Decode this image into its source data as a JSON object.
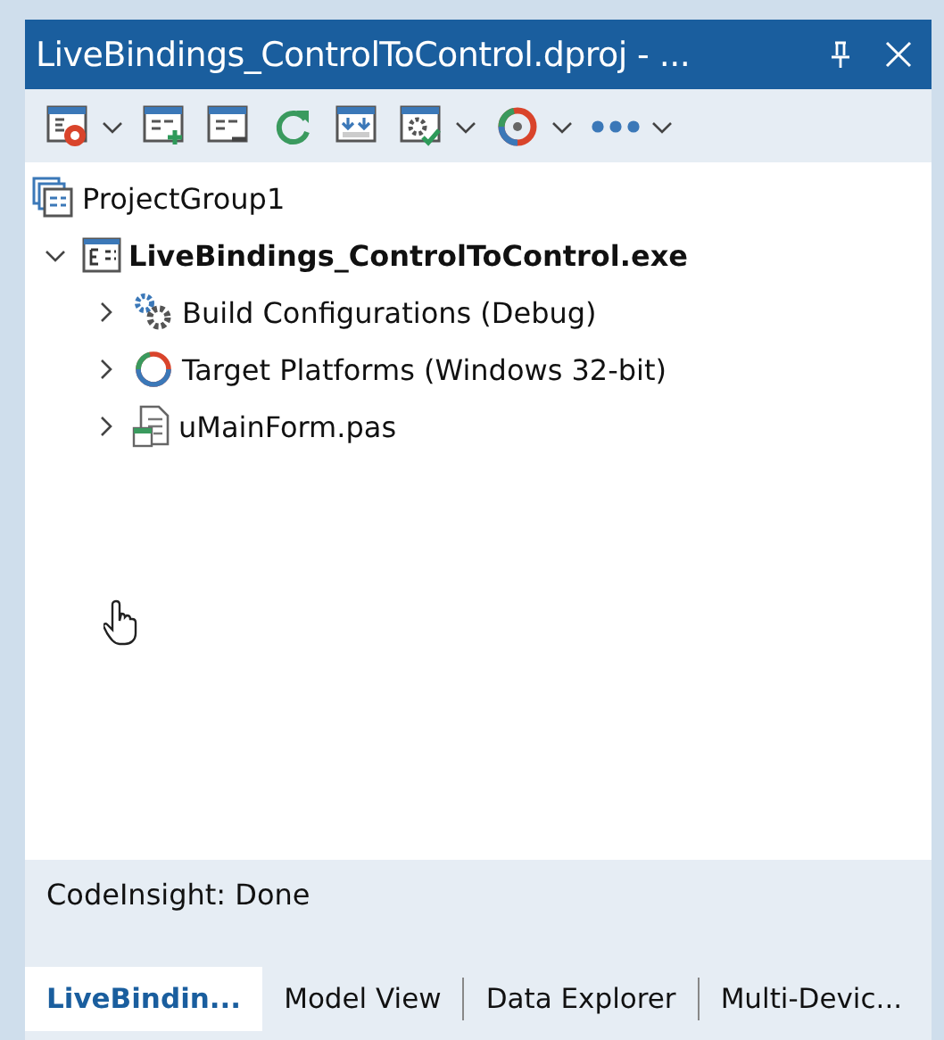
{
  "window": {
    "title": "LiveBindings_ControlToControl.dproj - ..."
  },
  "toolbar": [
    {
      "kind": "activate",
      "menu": true
    },
    {
      "kind": "add",
      "menu": false
    },
    {
      "kind": "remove",
      "menu": false
    },
    {
      "kind": "refresh",
      "menu": false
    },
    {
      "kind": "sync",
      "menu": false
    },
    {
      "kind": "build",
      "menu": true
    },
    {
      "kind": "platforms",
      "menu": true
    },
    {
      "kind": "more",
      "menu": true
    }
  ],
  "tree": [
    {
      "kind": "group",
      "label": "ProjectGroup1",
      "children": [
        {
          "kind": "project",
          "label": "LiveBindings_ControlToControl.exe",
          "expanded": true,
          "active": true,
          "children": [
            {
              "kind": "configs",
              "label": "Build Configurations (Debug)",
              "expanded": false,
              "active": false
            },
            {
              "kind": "platforms",
              "label": "Target Platforms (Windows 32-bit)",
              "expanded": false,
              "active": false
            },
            {
              "kind": "file",
              "label": "uMainForm.pas",
              "expanded": false,
              "active": false
            }
          ]
        }
      ]
    }
  ],
  "status": "CodeInsight: Done",
  "tabs": [
    {
      "label": "LiveBindin...",
      "selected": true
    },
    {
      "label": "Model View",
      "selected": false
    },
    {
      "label": "Data Explorer",
      "selected": false
    },
    {
      "label": "Multi-Devic...",
      "selected": false
    }
  ]
}
